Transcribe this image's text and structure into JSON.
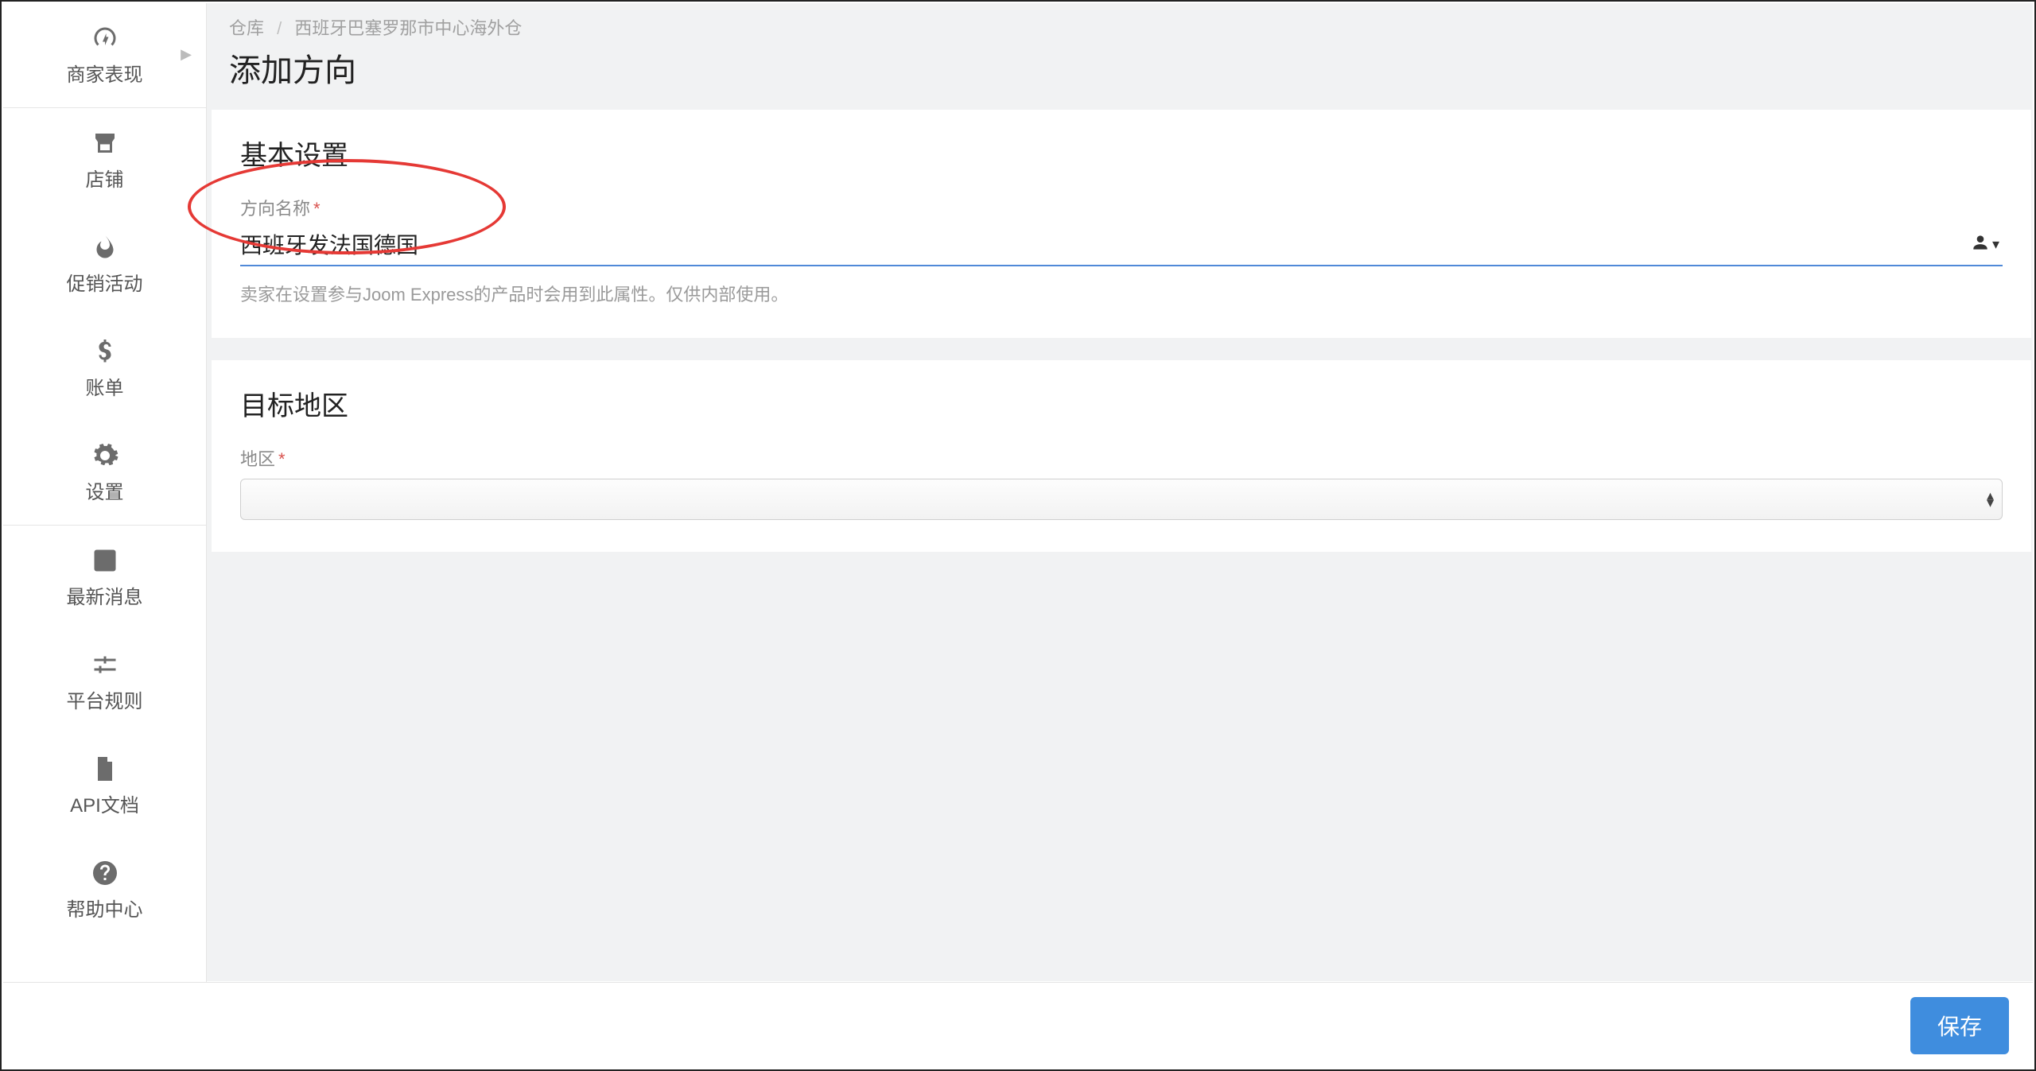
{
  "sidebar": {
    "items": [
      {
        "label": "商家表现",
        "icon": "gauge"
      },
      {
        "label": "店铺",
        "icon": "storefront"
      },
      {
        "label": "促销活动",
        "icon": "flame"
      },
      {
        "label": "账单",
        "icon": "dollar"
      },
      {
        "label": "设置",
        "icon": "gear"
      },
      {
        "label": "最新消息",
        "icon": "note"
      },
      {
        "label": "平台规则",
        "icon": "sliders"
      },
      {
        "label": "API文档",
        "icon": "file"
      },
      {
        "label": "帮助中心",
        "icon": "question"
      }
    ]
  },
  "breadcrumb": {
    "root": "仓库",
    "leaf": "西班牙巴塞罗那市中心海外仓"
  },
  "page": {
    "title": "添加方向"
  },
  "basic": {
    "section_title": "基本设置",
    "name_label": "方向名称",
    "name_value": "西班牙发法国德国",
    "help": "卖家在设置参与Joom Express的产品时会用到此属性。仅供内部使用。"
  },
  "target": {
    "section_title": "目标地区",
    "region_label": "地区",
    "region_value": ""
  },
  "footer": {
    "save": "保存"
  }
}
